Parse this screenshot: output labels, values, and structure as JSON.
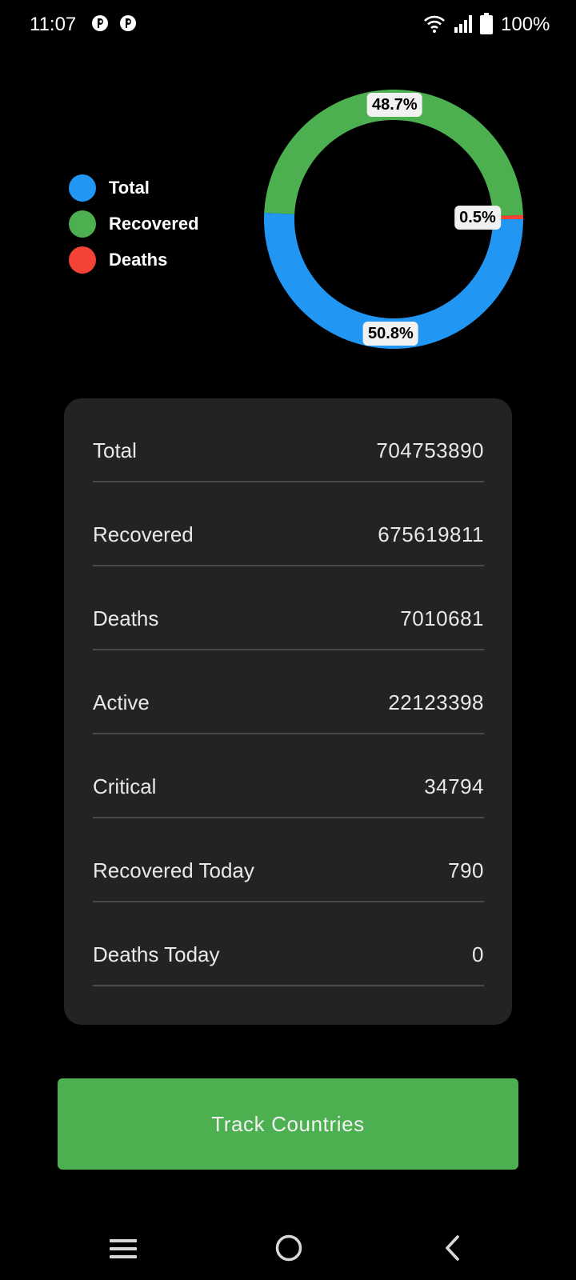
{
  "status_bar": {
    "time": "11:07",
    "battery_text": "100%"
  },
  "colors": {
    "total": "#2196f3",
    "recovered": "#4caf50",
    "deaths": "#f44336",
    "button": "#4caf50",
    "card": "#232323"
  },
  "legend": {
    "items": [
      {
        "label": "Total",
        "color": "#2196f3"
      },
      {
        "label": "Recovered",
        "color": "#4caf50"
      },
      {
        "label": "Deaths",
        "color": "#f44336"
      }
    ]
  },
  "chart_data": {
    "type": "pie",
    "categories": [
      "Total",
      "Recovered",
      "Deaths"
    ],
    "values": [
      50.8,
      48.7,
      0.5
    ],
    "value_labels": [
      "50.8%",
      "48.7%",
      "0.5%"
    ],
    "colors": [
      "#2196f3",
      "#4caf50",
      "#f44336"
    ],
    "style": "donut",
    "legend_position": "left"
  },
  "stats": {
    "rows": [
      {
        "label": "Total",
        "value": "704753890"
      },
      {
        "label": "Recovered",
        "value": "675619811"
      },
      {
        "label": "Deaths",
        "value": "7010681"
      },
      {
        "label": "Active",
        "value": "22123398"
      },
      {
        "label": "Critical",
        "value": "34794"
      },
      {
        "label": "Recovered Today",
        "value": "790"
      },
      {
        "label": "Deaths Today",
        "value": "0"
      }
    ]
  },
  "actions": {
    "track_countries_label": "Track Countries"
  },
  "nav_bar": {
    "icons": [
      "menu-icon",
      "home-icon",
      "back-icon"
    ]
  }
}
